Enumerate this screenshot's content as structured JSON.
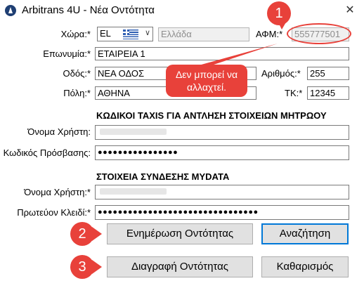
{
  "window": {
    "title": "Arbitrans 4U - Νέα Οντότητα",
    "close": "✕"
  },
  "labels": {
    "country": "Χώρα:*",
    "vat": "ΑΦΜ:*",
    "name": "Επωνυμία:*",
    "street": "Οδός:*",
    "number": "Αριθμός:*",
    "city": "Πόλη:*",
    "zip": "ΤΚ:*"
  },
  "values": {
    "country_code": "EL",
    "country_name": "Ελλάδα",
    "vat": "555777501",
    "name": "ΕΤΑΙΡΕΙΑ 1",
    "street": "ΝΕΑ ΟΔΟΣ",
    "number": "255",
    "city": "ΑΘΗΝΑ",
    "zip": "12345"
  },
  "taxis": {
    "heading": "ΚΩΔΙΚΟΙ TAXIS ΓΙΑ ΑΝΤΛΗΣΗ ΣΤΟΙΧΕΙΩΝ ΜΗΤΡΩΟΥ",
    "username_label": "Όνομα Χρήστη:",
    "password_label": "Κωδικός Πρόσβασης:",
    "password_value": "●●●●●●●●●●●●●●●●"
  },
  "mydata": {
    "heading": "ΣΤΟΙΧΕΙΑ ΣΥΝΔΕΣΗΣ MYDATA",
    "username_label": "Όνομα Χρήστη:*",
    "key_label": "Πρωτεύον Κλειδί:*",
    "key_value": "●●●●●●●●●●●●●●●●●●●●●●●●●●●●●●●●"
  },
  "buttons": {
    "update": "Ενημέρωση Οντότητας",
    "search": "Αναζήτηση",
    "delete": "Διαγραφή Οντότητας",
    "clear": "Καθαρισμός"
  },
  "annotations": {
    "badge1": "1",
    "badge2": "2",
    "badge3": "3",
    "callout": "Δεν μπορεί να αλλαχτεί."
  },
  "colors": {
    "accent": "#e8413a",
    "focus": "#0078d7",
    "flag": "#2f5fb3"
  },
  "icons": {
    "app": "arbitrans-logo-icon",
    "flag": "greek-flag-icon",
    "dropdown": "chevron-down-icon"
  }
}
